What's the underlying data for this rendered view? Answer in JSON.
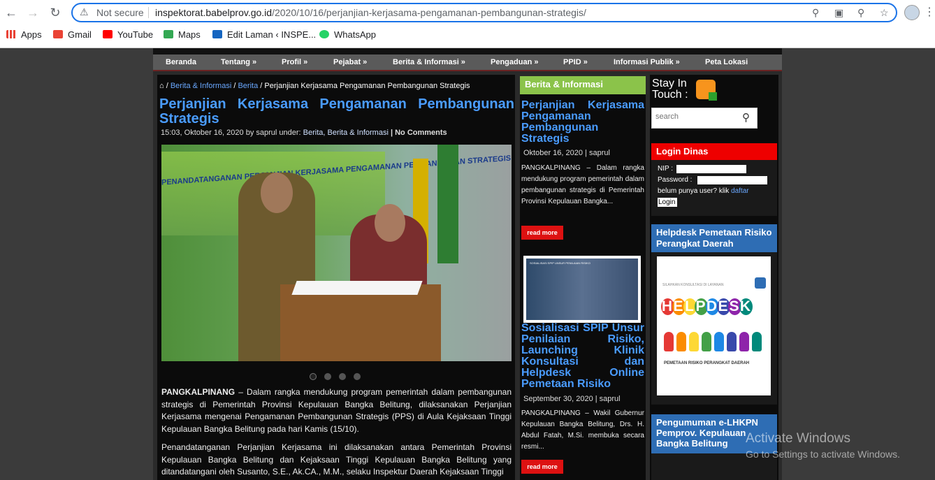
{
  "browser": {
    "security_label": "Not secure",
    "url_host": "inspektorat.babelprov.go.id",
    "url_path": "/2020/10/16/perjanjian-kerjasama-pengamanan-pembangunan-strategis/",
    "bookmarks": [
      {
        "label": "Apps",
        "icon": "apps-grid-icon"
      },
      {
        "label": "Gmail",
        "icon": "gmail-icon"
      },
      {
        "label": "YouTube",
        "icon": "youtube-icon"
      },
      {
        "label": "Maps",
        "icon": "maps-icon"
      },
      {
        "label": "Edit Laman ‹ INSPE...",
        "icon": "site-icon"
      },
      {
        "label": "WhatsApp",
        "icon": "whatsapp-icon"
      }
    ]
  },
  "nav": {
    "items": [
      "Beranda",
      "Tentang »",
      "Profil »",
      "Pejabat »",
      "Berita & Informasi »",
      "Pengaduan »",
      "PPID »",
      "Informasi Publik »",
      "Peta Lokasi"
    ]
  },
  "breadcrumb": {
    "sep": "/",
    "cat1": "Berita & Informasi",
    "cat2": "Berita",
    "current": "Perjanjian Kerjasama Pengamanan Pembangunan Strategis"
  },
  "post": {
    "title": "Perjanjian Kerjasama Pengamanan Pembangunan Strategis",
    "meta_time": "15:03, Oktober 16, 2020 by saprul under: ",
    "meta_cats": "Berita, Berita & Informasi",
    "meta_comments": " | No Comments",
    "photo_caption": "PENANDATANGANAN PERJANJIAN KERJASAMA PENGAMANAN PEMBANGUNAN STRATEGIS (PPS)",
    "para1_lead": "PANGKALPINANG",
    "para1": " – Dalam rangka mendukung program pemerintah dalam pembangunan strategis di Pemerintah Provinsi Kepulauan Bangka Belitung, dilaksanakan Perjanjian Kerjasama  mengenai Pengamanan Pembangunan Strategis (PPS) di Aula Kejaksaan Tinggi Kepulauan Bangka Belitung pada hari Kamis (15/10).",
    "para2": "Penandatanganan Perjanjian Kerjasama ini dilaksanakan antara Pemerintah Provinsi Kepulauan Bangka Belitung dan Kejaksaan Tinggi Kepulauan Bangka Belitung yang ditandatangani oleh Susanto, S.E., Ak.CA., M.M., selaku Inspektur Daerah Kejaksaan Tinggi"
  },
  "news": {
    "header": "Berita & Informasi",
    "items": [
      {
        "title": "Perjanjian Kerjasama Pengamanan Pembangunan Strategis",
        "meta": "Oktober 16, 2020 | saprul",
        "excerpt": "PANGKALPINANG – Dalam rangka mendukung program pemerintah dalam pembangunan strategis di Pemerintah Provinsi Kepulauan Bangka...",
        "more": "read more"
      },
      {
        "title": "Sosialisasi SPIP Unsur Penilaian Risiko, Launching Klinik Konsultasi dan Helpdesk Online Pemetaan Risiko",
        "meta": "September 30, 2020 | saprul",
        "excerpt": "PANGKALPINANG – Wakil Gubernur Kepulauan Bangka Belitung, Drs. H. Abdul Fatah, M.Si.  membuka secara resmi...",
        "more": "read more",
        "thumb_text": "SOSIALISASI SPIP UNSUR PENILAIAN RISIKO"
      }
    ]
  },
  "sidebar": {
    "stay_in_touch": "Stay In Touch :",
    "search_placeholder": "search",
    "login_title": "Login Dinas",
    "nip_label": "NIP :",
    "password_label": "Password :",
    "signup_text": "belum punya user? klik ",
    "signup_link": "daftar",
    "login_button": "Login",
    "helpdesk_title": "Helpdesk Pemetaan Risiko Perangkat Daerah",
    "helpdesk_banner_top": "SILAHKAN KONSULTASI DI LAYANAN",
    "helpdesk_word": "HELPDESK",
    "helpdesk_caption": "PEMETAAN RISIKO PERANGKAT DAERAH",
    "pengumuman_title": "Pengumuman e-LHKPN Pemprov. Kepulauan Bangka Belitung"
  },
  "watermark": {
    "line1": "Activate Windows",
    "line2": "Go to Settings to activate Windows."
  }
}
